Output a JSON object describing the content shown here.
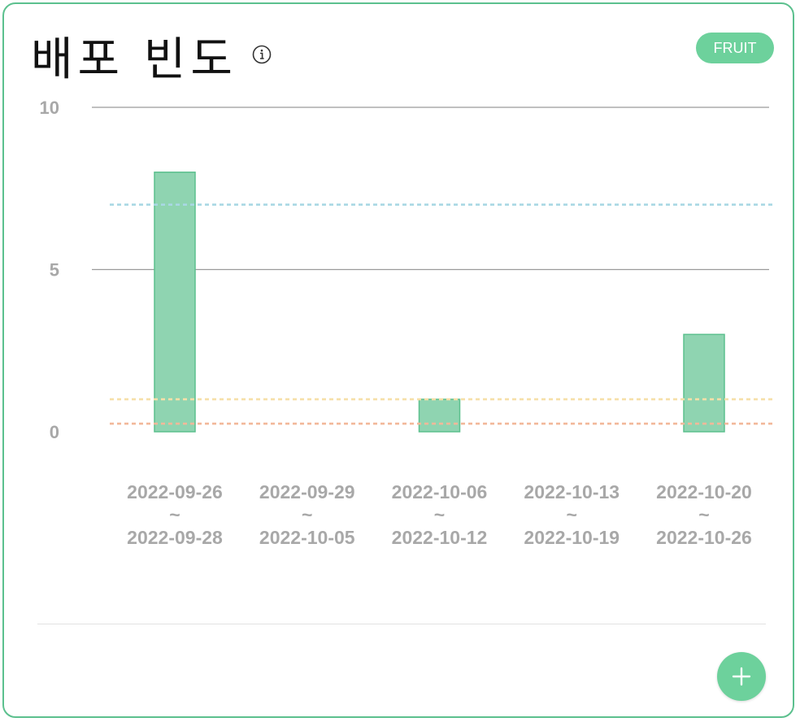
{
  "card": {
    "title": "배포 빈도",
    "badge": "FRUIT"
  },
  "colors": {
    "accent": "#6dd19c",
    "bar_fill": "#8fd4b1",
    "bar_stroke": "#5cc08e",
    "threshold_blue": "#a9d8e4",
    "threshold_yellow": "#f6dfa8",
    "threshold_orange": "#f2b89a"
  },
  "chart_data": {
    "type": "bar",
    "categories": [
      [
        "2022-09-26",
        "~",
        "2022-09-28"
      ],
      [
        "2022-09-29",
        "~",
        "2022-10-05"
      ],
      [
        "2022-10-06",
        "~",
        "2022-10-12"
      ],
      [
        "2022-10-13",
        "~",
        "2022-10-19"
      ],
      [
        "2022-10-20",
        "~",
        "2022-10-26"
      ]
    ],
    "values": [
      8,
      0,
      1,
      0,
      3
    ],
    "ylim": [
      0,
      10
    ],
    "yticks": [
      0,
      5,
      10
    ],
    "threshold_lines": [
      {
        "value": 7,
        "style": "dashed",
        "color": "#a9d8e4"
      },
      {
        "value": 1,
        "style": "dashed",
        "color": "#f6dfa8"
      },
      {
        "value": 0.25,
        "style": "dashed",
        "color": "#f2b89a"
      }
    ],
    "grid": true,
    "legend": "none"
  },
  "icons": {
    "info": "info-icon",
    "add": "plus-icon"
  }
}
